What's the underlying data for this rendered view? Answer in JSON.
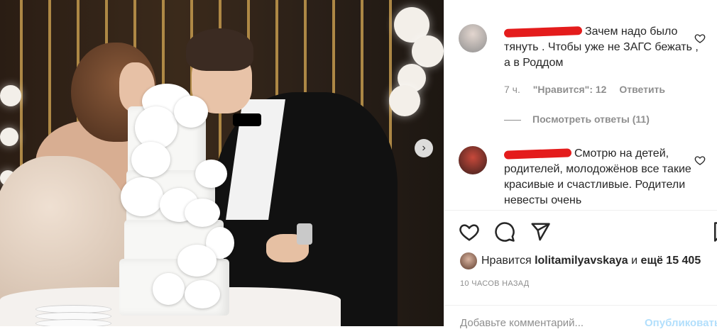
{
  "post_photo": {
    "alt": "photo",
    "next_icon": "chevron-right-icon"
  },
  "comments": [
    {
      "user": "redacted",
      "text": "Зачем надо было тянуть . Чтобы уже не ЗАГС бежать , а в Роддом",
      "time": "7 ч.",
      "likes": "\"Нравится\": 12",
      "reply": "Ответить",
      "view_replies": "Посмотреть ответы (11)"
    },
    {
      "user": "redacted",
      "text": "Смотрю на детей, родителей, молодожёнов все такие красивые и счастливые. Родители невесты очень"
    }
  ],
  "actions": {
    "like_icon": "heart-icon",
    "comment_icon": "comment-bubble-icon",
    "share_icon": "paper-plane-icon",
    "save_icon": "bookmark-icon"
  },
  "likes_line": {
    "prefix": "Нравится",
    "user": "lolitamilyavskaya",
    "middle": "и",
    "rest": "ещё 15 405"
  },
  "posted_ago": "10 ЧАСОВ НАЗАД",
  "add_comment": {
    "placeholder": "Добавьте комментарий...",
    "publish": "Опубликовать"
  },
  "colors": {
    "text": "#262626",
    "muted": "#8e8e8e",
    "link_disabled": "#b2dffc",
    "redaction": "#e41c1c"
  }
}
